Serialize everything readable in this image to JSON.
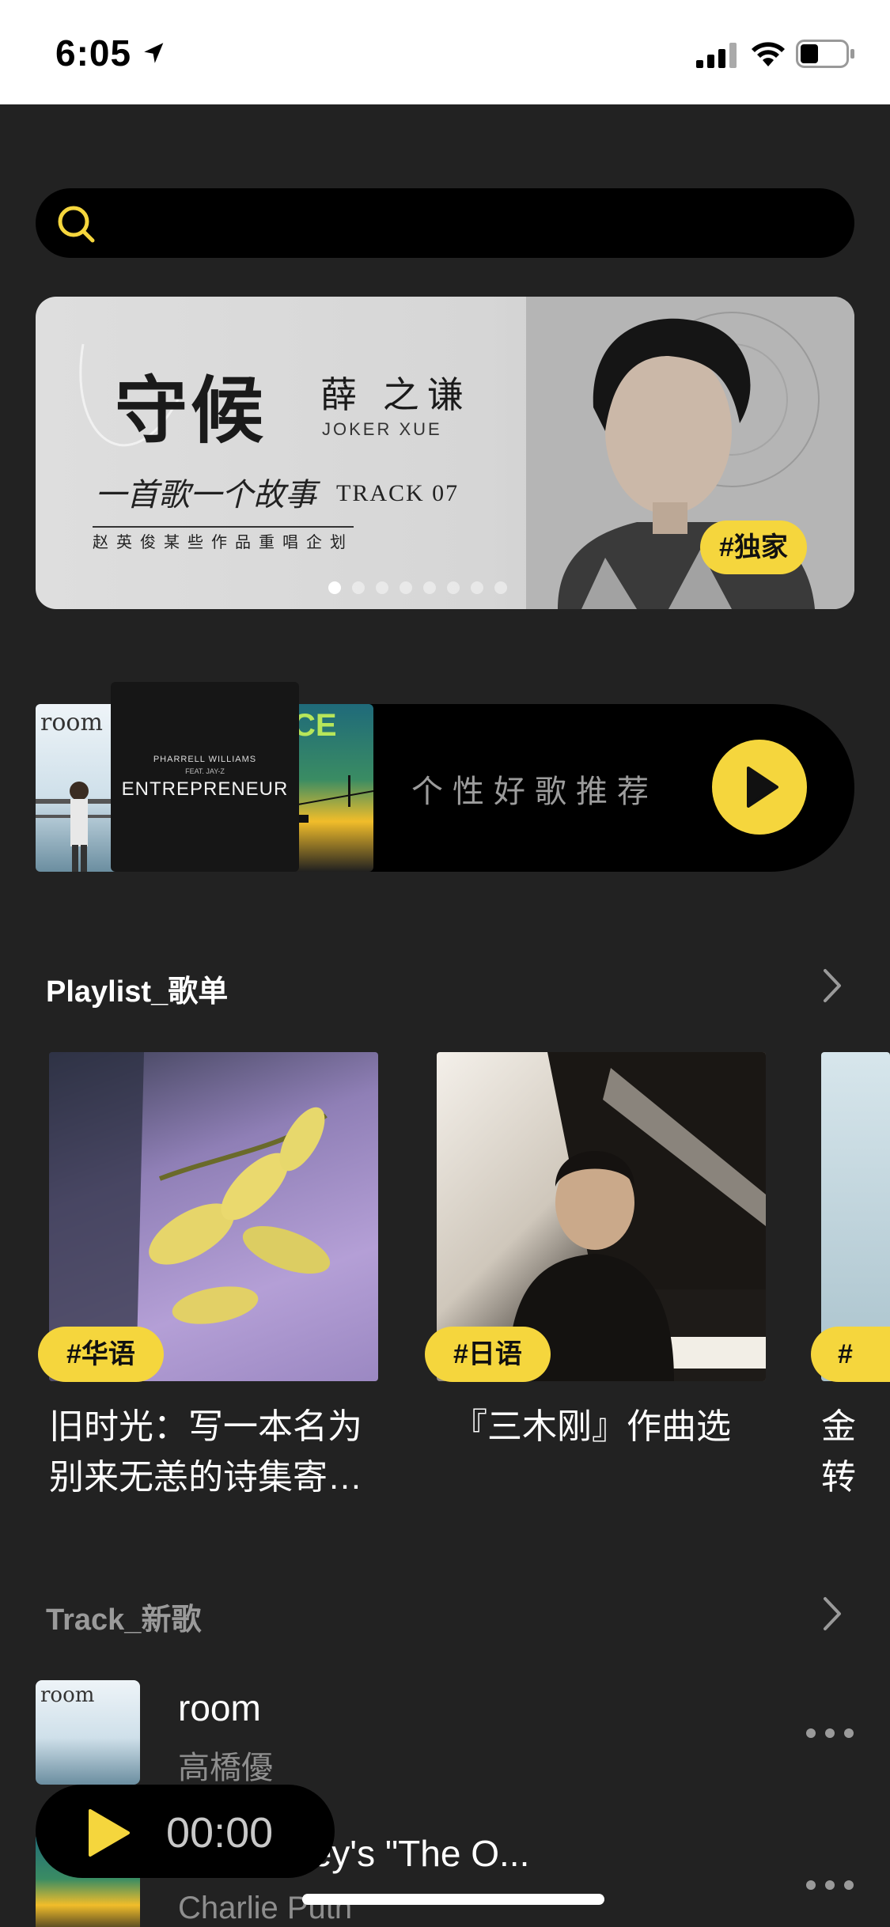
{
  "status_bar": {
    "time": "6:05"
  },
  "search": {
    "placeholder": ""
  },
  "banner": {
    "title": "守候",
    "artist_cn": "薛 之谦",
    "artist_en": "JOKER XUE",
    "subtitle": "一首歌一个故事",
    "track": "TRACK 07",
    "caption": "赵英俊某些作品重唱企划",
    "tag": "#独家",
    "page_count": 8,
    "active_page": 0
  },
  "recommend": {
    "label": "个性好歌推荐",
    "covers": [
      {
        "name": "room",
        "text": "room"
      },
      {
        "name": "entrepreneur",
        "artist": "PHARRELL WILLIAMS",
        "feat": "FEAT. JAY-Z",
        "title": "ENTREPRENEUR"
      }
    ]
  },
  "playlist_section": {
    "title": "Playlist_歌单"
  },
  "playlists": [
    {
      "tag": "#华语",
      "name": "旧时光：写一本名为别来无恙的诗集寄…"
    },
    {
      "tag": "#日语",
      "name": "『三木刚』作曲选"
    },
    {
      "tag": "#",
      "name": "金转"
    }
  ],
  "track_section": {
    "title": "Track_新歌"
  },
  "tracks": [
    {
      "title": "room",
      "artist": "高橋優",
      "cover_text": "room"
    },
    {
      "title": "om Disney's \"The O...",
      "artist": "Charlie Puth"
    }
  ],
  "player": {
    "time": "00:00"
  },
  "colors": {
    "accent": "#f5d63d",
    "background": "#222222",
    "card": "#000000"
  }
}
